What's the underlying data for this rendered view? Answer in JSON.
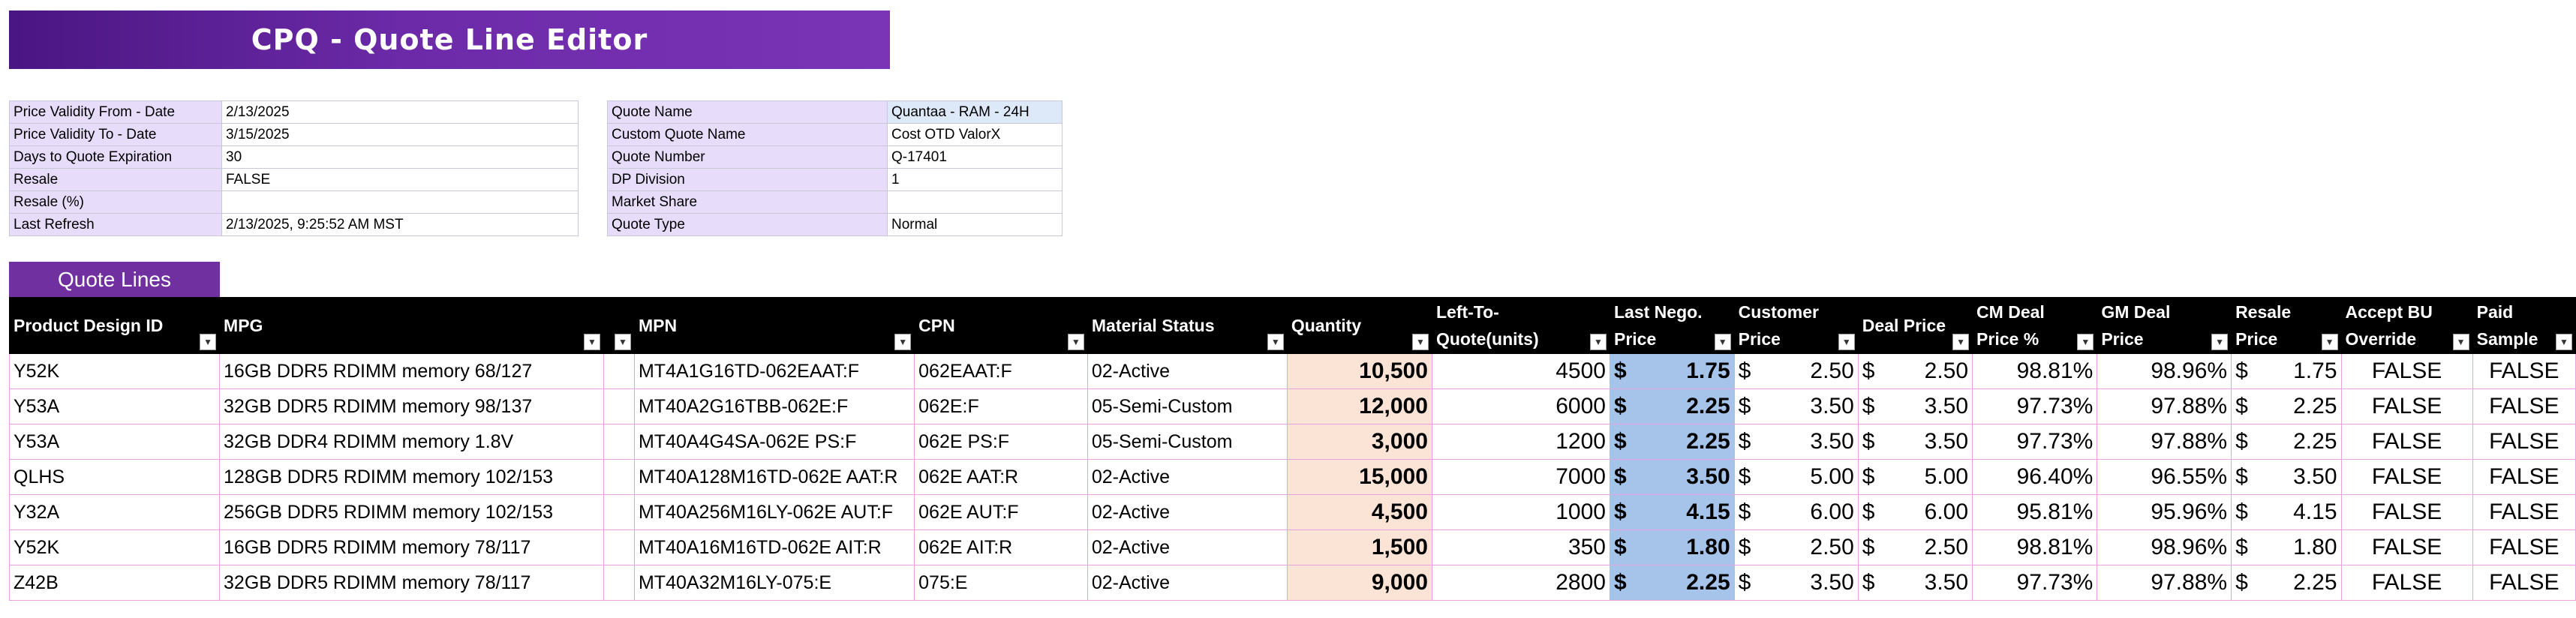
{
  "banner": {
    "title": "CPQ - Quote Line Editor"
  },
  "info_left": [
    {
      "label": "Price Validity From - Date",
      "value": "2/13/2025"
    },
    {
      "label": "Price Validity To - Date",
      "value": "3/15/2025"
    },
    {
      "label": "Days to Quote Expiration",
      "value": "30"
    },
    {
      "label": "Resale",
      "value": "FALSE"
    },
    {
      "label": "Resale (%)",
      "value": ""
    },
    {
      "label": "Last Refresh",
      "value": "2/13/2025, 9:25:52 AM MST"
    }
  ],
  "info_right": [
    {
      "label": "Quote Name",
      "value": "Quantaa - RAM - 24H"
    },
    {
      "label": "Custom Quote Name",
      "value": "Cost OTD ValorX"
    },
    {
      "label": "Quote Number",
      "value": "Q-17401"
    },
    {
      "label": "DP Division",
      "value": "1"
    },
    {
      "label": "Market Share",
      "value": ""
    },
    {
      "label": "Quote Type",
      "value": "Normal"
    }
  ],
  "quote_lines_tab": "Quote Lines",
  "columns": [
    "Product Design ID",
    "MPG",
    "",
    "MPN",
    "CPN",
    "Material Status",
    "Quantity",
    "Left-To-Quote(units)",
    "Last Nego. Price",
    "Customer Price",
    "Deal Price",
    "CM Deal Price %",
    "GM Deal Price",
    "Resale Price",
    "Accept BU Override",
    "Paid Sample"
  ],
  "columns_lines": [
    [
      "Product Design ID"
    ],
    [
      "MPG"
    ],
    [
      ""
    ],
    [
      "MPN"
    ],
    [
      "CPN"
    ],
    [
      "Material Status"
    ],
    [
      "Quantity"
    ],
    [
      "Left-To-",
      "Quote(units)"
    ],
    [
      "Last Nego.",
      "Price"
    ],
    [
      "Customer",
      "Price"
    ],
    [
      "Deal Price"
    ],
    [
      "CM Deal",
      "Price %"
    ],
    [
      "GM Deal",
      "Price"
    ],
    [
      "Resale",
      "Price"
    ],
    [
      "Accept BU",
      "Override"
    ],
    [
      "Paid",
      "Sample"
    ]
  ],
  "rows": [
    {
      "pdid": "Y52K",
      "mpg": "16GB DDR5 RDIMM memory 68/127",
      "mpn": "MT4A1G16TD-062EAAT:F",
      "cpn": "062EAAT:F",
      "status": "02-Active",
      "qty": "10,500",
      "ltq": "4500",
      "last_nego": "1.75",
      "cust_price": "2.50",
      "deal_price": "2.50",
      "cm_pct": "98.81%",
      "gm_price": "98.96%",
      "resale": "1.75",
      "accept_bu": "FALSE",
      "paid_sample": "FALSE"
    },
    {
      "pdid": "Y53A",
      "mpg": "32GB DDR5 RDIMM memory 98/137",
      "mpn": "MT40A2G16TBB-062E:F",
      "cpn": "062E:F",
      "status": "05-Semi-Custom",
      "qty": "12,000",
      "ltq": "6000",
      "last_nego": "2.25",
      "cust_price": "3.50",
      "deal_price": "3.50",
      "cm_pct": "97.73%",
      "gm_price": "97.88%",
      "resale": "2.25",
      "accept_bu": "FALSE",
      "paid_sample": "FALSE"
    },
    {
      "pdid": "Y53A",
      "mpg": "32GB DDR4 RDIMM memory 1.8V",
      "mpn": "MT40A4G4SA-062E PS:F",
      "cpn": "062E PS:F",
      "status": "05-Semi-Custom",
      "qty": "3,000",
      "ltq": "1200",
      "last_nego": "2.25",
      "cust_price": "3.50",
      "deal_price": "3.50",
      "cm_pct": "97.73%",
      "gm_price": "97.88%",
      "resale": "2.25",
      "accept_bu": "FALSE",
      "paid_sample": "FALSE"
    },
    {
      "pdid": "QLHS",
      "mpg": "128GB DDR5 RDIMM memory 102/153",
      "mpn": "MT40A128M16TD-062E AAT:R",
      "cpn": "062E AAT:R",
      "status": "02-Active",
      "qty": "15,000",
      "ltq": "7000",
      "last_nego": "3.50",
      "cust_price": "5.00",
      "deal_price": "5.00",
      "cm_pct": "96.40%",
      "gm_price": "96.55%",
      "resale": "3.50",
      "accept_bu": "FALSE",
      "paid_sample": "FALSE"
    },
    {
      "pdid": "Y32A",
      "mpg": "256GB DDR5 RDIMM memory 102/153",
      "mpn": "MT40A256M16LY-062E AUT:F",
      "cpn": "062E AUT:F",
      "status": "02-Active",
      "qty": "4,500",
      "ltq": "1000",
      "last_nego": "4.15",
      "cust_price": "6.00",
      "deal_price": "6.00",
      "cm_pct": "95.81%",
      "gm_price": "95.96%",
      "resale": "4.15",
      "accept_bu": "FALSE",
      "paid_sample": "FALSE"
    },
    {
      "pdid": "Y52K",
      "mpg": "16GB DDR5 RDIMM memory 78/117",
      "mpn": "MT40A16M16TD-062E AIT:R",
      "cpn": "062E AIT:R",
      "status": "02-Active",
      "qty": "1,500",
      "ltq": "350",
      "last_nego": "1.80",
      "cust_price": "2.50",
      "deal_price": "2.50",
      "cm_pct": "98.81%",
      "gm_price": "98.96%",
      "resale": "1.80",
      "accept_bu": "FALSE",
      "paid_sample": "FALSE"
    },
    {
      "pdid": "Z42B",
      "mpg": "32GB DDR5 RDIMM memory 78/117",
      "mpn": "MT40A32M16LY-075:E",
      "cpn": "075:E",
      "status": "02-Active",
      "qty": "9,000",
      "ltq": "2800",
      "last_nego": "2.25",
      "cust_price": "3.50",
      "deal_price": "3.50",
      "cm_pct": "97.73%",
      "gm_price": "97.88%",
      "resale": "2.25",
      "accept_bu": "FALSE",
      "paid_sample": "FALSE"
    }
  ],
  "currency_symbol": "$",
  "icons": {
    "filter": "filter-dropdown-icon"
  }
}
